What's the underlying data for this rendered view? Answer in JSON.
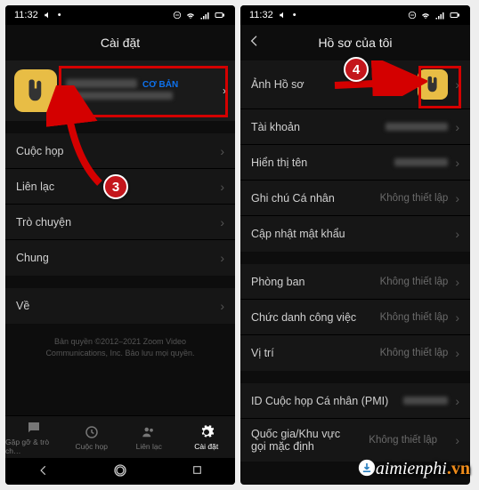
{
  "status": {
    "time": "11:32"
  },
  "left": {
    "title": "Cài đặt",
    "profile": {
      "badge": "CƠ BẢN"
    },
    "rows": {
      "meeting": "Cuộc họp",
      "contacts": "Liên lạc",
      "chat": "Trò chuyện",
      "general": "Chung",
      "about": "Về"
    },
    "copyright": "Bản quyền ©2012–2021 Zoom Video Communications, Inc. Bảo lưu mọi quyền.",
    "tabs": {
      "meet": "Gặp gỡ & trò ch…",
      "meetings": "Cuộc họp",
      "contacts": "Liên lạc",
      "settings": "Cài đặt"
    }
  },
  "right": {
    "title": "Hồ sơ của tôi",
    "rows": {
      "photo": "Ảnh Hồ sơ",
      "account": "Tài khoản",
      "display": "Hiển thị tên",
      "note": "Ghi chú Cá nhân",
      "password": "Cập nhật mật khẩu",
      "department": "Phòng ban",
      "jobtitle": "Chức danh công việc",
      "location": "Vị trí",
      "pmi": "ID Cuộc họp Cá nhân (PMI)",
      "region": "Quốc gia/Khu vực gọi mặc định"
    },
    "values": {
      "notset": "Không thiết lập"
    }
  },
  "ann": {
    "n3": "3",
    "n4": "4"
  },
  "watermark": {
    "a": "aimienphi",
    "b": ".vn"
  }
}
